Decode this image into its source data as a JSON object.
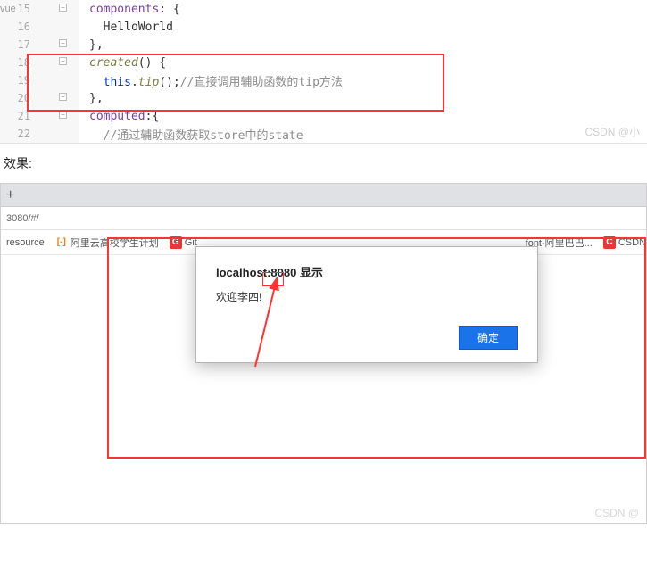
{
  "editor": {
    "gutter_label": "vue",
    "lines": [
      {
        "num": "15",
        "fold": true,
        "tokens": [
          {
            "t": "components",
            "c": "kw-prop"
          },
          {
            "t": ": {",
            "c": "kw-brace"
          }
        ]
      },
      {
        "num": "16",
        "fold": false,
        "tokens": [
          {
            "t": "  HelloWorld",
            "c": "kw-ident"
          }
        ]
      },
      {
        "num": "17",
        "fold": true,
        "tokens": [
          {
            "t": "},",
            "c": "kw-brace"
          }
        ]
      },
      {
        "num": "18",
        "fold": true,
        "tokens": [
          {
            "t": "created",
            "c": "kw-method"
          },
          {
            "t": "() {",
            "c": "kw-brace"
          }
        ]
      },
      {
        "num": "19",
        "fold": false,
        "tokens": [
          {
            "t": "  this",
            "c": "kw-this"
          },
          {
            "t": ".",
            "c": "kw-brace"
          },
          {
            "t": "tip",
            "c": "kw-method"
          },
          {
            "t": "();",
            "c": "kw-brace"
          },
          {
            "t": "//直接调用辅助函数的tip方法",
            "c": "kw-comment"
          }
        ]
      },
      {
        "num": "20",
        "fold": true,
        "tokens": [
          {
            "t": "},",
            "c": "kw-brace"
          }
        ]
      },
      {
        "num": "21",
        "fold": true,
        "tokens": [
          {
            "t": "computed",
            "c": "kw-prop"
          },
          {
            "t": ":{",
            "c": "kw-brace"
          }
        ]
      },
      {
        "num": "22",
        "fold": false,
        "tokens": [
          {
            "t": "  //通过辅助函数获取store中的state",
            "c": "kw-comment"
          }
        ]
      }
    ],
    "watermark": "CSDN @小"
  },
  "effect_label": "效果:",
  "browser": {
    "tab_plus": "+",
    "address": "3080/#/",
    "bookmarks": [
      {
        "icon_class": "",
        "label": "resource"
      },
      {
        "icon_class": "ico-orange",
        "icon_text": "[-]",
        "label": "阿里云高校学生计划"
      },
      {
        "icon_class": "ico-red",
        "icon_text": "G",
        "label": "Git"
      },
      {
        "icon_class": "",
        "label": ""
      },
      {
        "icon_class": "",
        "label": "font-阿里巴巴..."
      },
      {
        "icon_class": "ico-redc",
        "icon_text": "C",
        "label": "CSDN"
      }
    ],
    "alert": {
      "title": "localhost:8080 显示",
      "message": "欢迎李四!",
      "button": "确定"
    },
    "watermark": "CSDN @"
  }
}
